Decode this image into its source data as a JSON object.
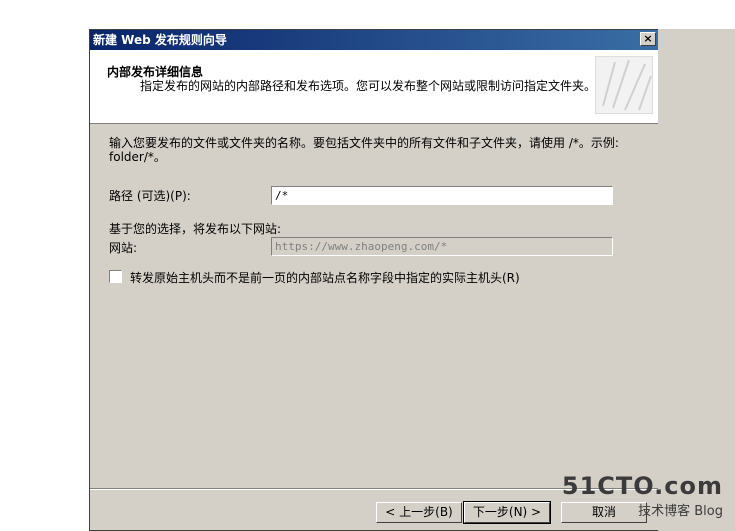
{
  "window": {
    "title": "新建 Web 发布规则向导",
    "close": "×"
  },
  "header": {
    "title": "内部发布详细信息",
    "description": "指定发布的网站的内部路径和发布选项。您可以发布整个网站或限制访问指定文件夹。"
  },
  "body": {
    "instruction": "输入您要发布的文件或文件夹的名称。要包括文件夹中的所有文件和子文件夹，请使用 /*。示例: folder/*。",
    "path_label": "路径 (可选)(P):",
    "path_value": "/*",
    "result_label": "基于您的选择，将发布以下网站:",
    "website_label": "网站:",
    "website_value": "https://www.zhaopeng.com/*",
    "forward_host_checkbox": "转发原始主机头而不是前一页的内部站点名称字段中指定的实际主机头(R)"
  },
  "buttons": {
    "back": "< 上一步(B)",
    "next": "下一步(N) >",
    "cancel": "取消"
  },
  "watermark": {
    "brand": "51CTO.com",
    "sub1": "技术博客",
    "sub2": "Blog"
  }
}
